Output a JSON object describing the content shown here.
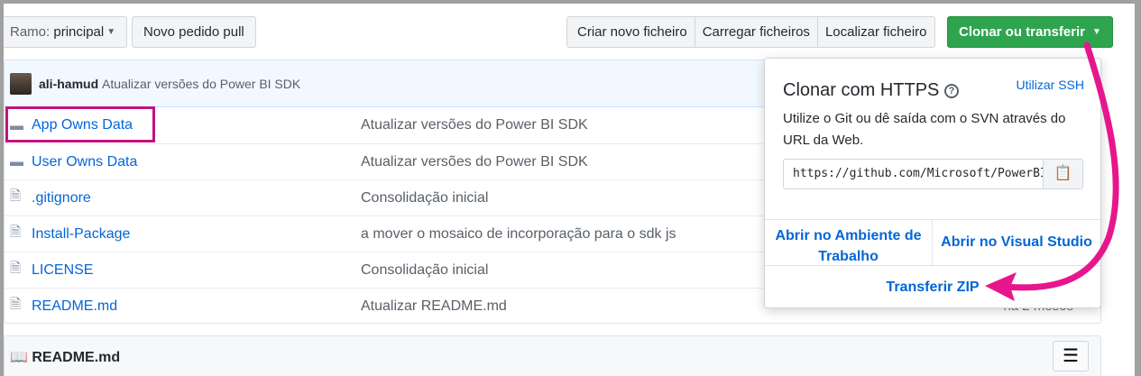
{
  "toolbar": {
    "branch_label": "Ramo:",
    "branch_value": "principal",
    "new_pr": "Novo pedido pull",
    "create_file": "Criar novo ficheiro",
    "upload_files": "Carregar ficheiros",
    "find_file": "Localizar ficheiro",
    "clone_download": "Clonar ou transferir"
  },
  "commit": {
    "author": "ali-hamud",
    "message": "Atualizar versões do Power BI SDK"
  },
  "files": [
    {
      "name": "App Owns Data",
      "type": "folder",
      "message": "Atualizar versões do Power BI SDK"
    },
    {
      "name": "User Owns Data",
      "type": "folder",
      "message": "Atualizar versões do Power BI SDK"
    },
    {
      "name": ".gitignore",
      "type": "file",
      "message": "Consolidação inicial"
    },
    {
      "name": "Install-Package",
      "type": "file",
      "message": "a mover o mosaico de incorporação para o sdk js"
    },
    {
      "name": "LICENSE",
      "type": "file",
      "message": "Consolidação inicial"
    },
    {
      "name": "README.md",
      "type": "file",
      "message": "Atualizar README.md",
      "age": "há 2 meses"
    }
  ],
  "popup": {
    "title": "Clonar com HTTPS",
    "use_ssh": "Utilizar SSH",
    "description": "Utilize o Git ou dê saída com o SVN através do URL da Web.",
    "url": "https://github.com/Microsoft/PowerBI-Developer-Samples.git",
    "open_desktop": "Abrir no Ambiente de Trabalho",
    "open_vs": "Abrir no Visual Studio",
    "download_zip": "Transferir ZIP"
  },
  "readme": {
    "title": "README.md"
  },
  "colors": {
    "accent": "#e6178c",
    "link": "#0366d6",
    "green": "#2ea44f"
  }
}
